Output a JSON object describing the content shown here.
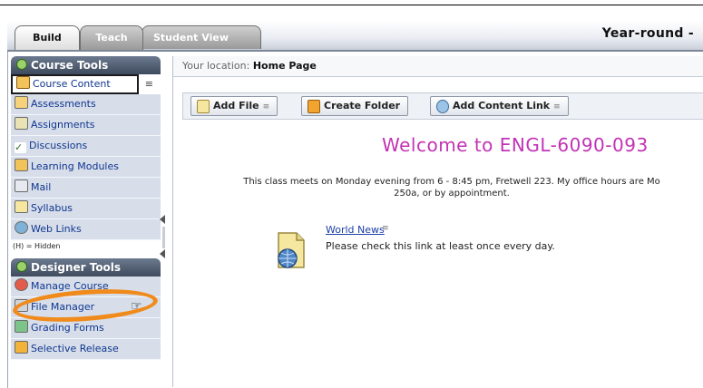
{
  "tabs": {
    "build": "Build",
    "teach": "Teach",
    "student_view": "Student View"
  },
  "course_title": "Year-round -",
  "sidebar": {
    "course_tools_heading": "Course Tools",
    "course_items": [
      {
        "label": "Course Content",
        "icon": "home-icon"
      },
      {
        "label": "Assessments",
        "icon": "assessment-icon"
      },
      {
        "label": "Assignments",
        "icon": "assignment-icon"
      },
      {
        "label": "Discussions",
        "icon": "discussion-icon"
      },
      {
        "label": "Learning Modules",
        "icon": "module-icon"
      },
      {
        "label": "Mail",
        "icon": "mail-icon"
      },
      {
        "label": "Syllabus",
        "icon": "syllabus-icon"
      },
      {
        "label": "Web Links",
        "icon": "web-link-icon"
      }
    ],
    "hidden_note": "(H) = Hidden",
    "designer_tools_heading": "Designer Tools",
    "designer_items": [
      {
        "label": "Manage Course",
        "icon": "manage-icon"
      },
      {
        "label": "File Manager",
        "icon": "file-manager-icon"
      },
      {
        "label": "Grading Forms",
        "icon": "grading-icon"
      },
      {
        "label": "Selective Release",
        "icon": "release-icon"
      }
    ]
  },
  "location": {
    "prefix": "Your location:",
    "page": "Home Page"
  },
  "toolbar": {
    "add_file": "Add File",
    "create_folder": "Create Folder",
    "add_content_link": "Add Content Link"
  },
  "welcome": "Welcome to ENGL-6090-093",
  "description": {
    "line1": "This class meets on Monday evening from 6 - 8:45 pm, Fretwell 223. My office hours are Mo",
    "line2": "250a, or by appointment."
  },
  "content_item": {
    "title": "World News",
    "description": "Please check this link at least once every day."
  },
  "colors": {
    "welcome": "#c233b5",
    "highlight_oval": "#f08a1b",
    "sidebar_bg": "#d7deea",
    "link": "#1b3fa5"
  }
}
